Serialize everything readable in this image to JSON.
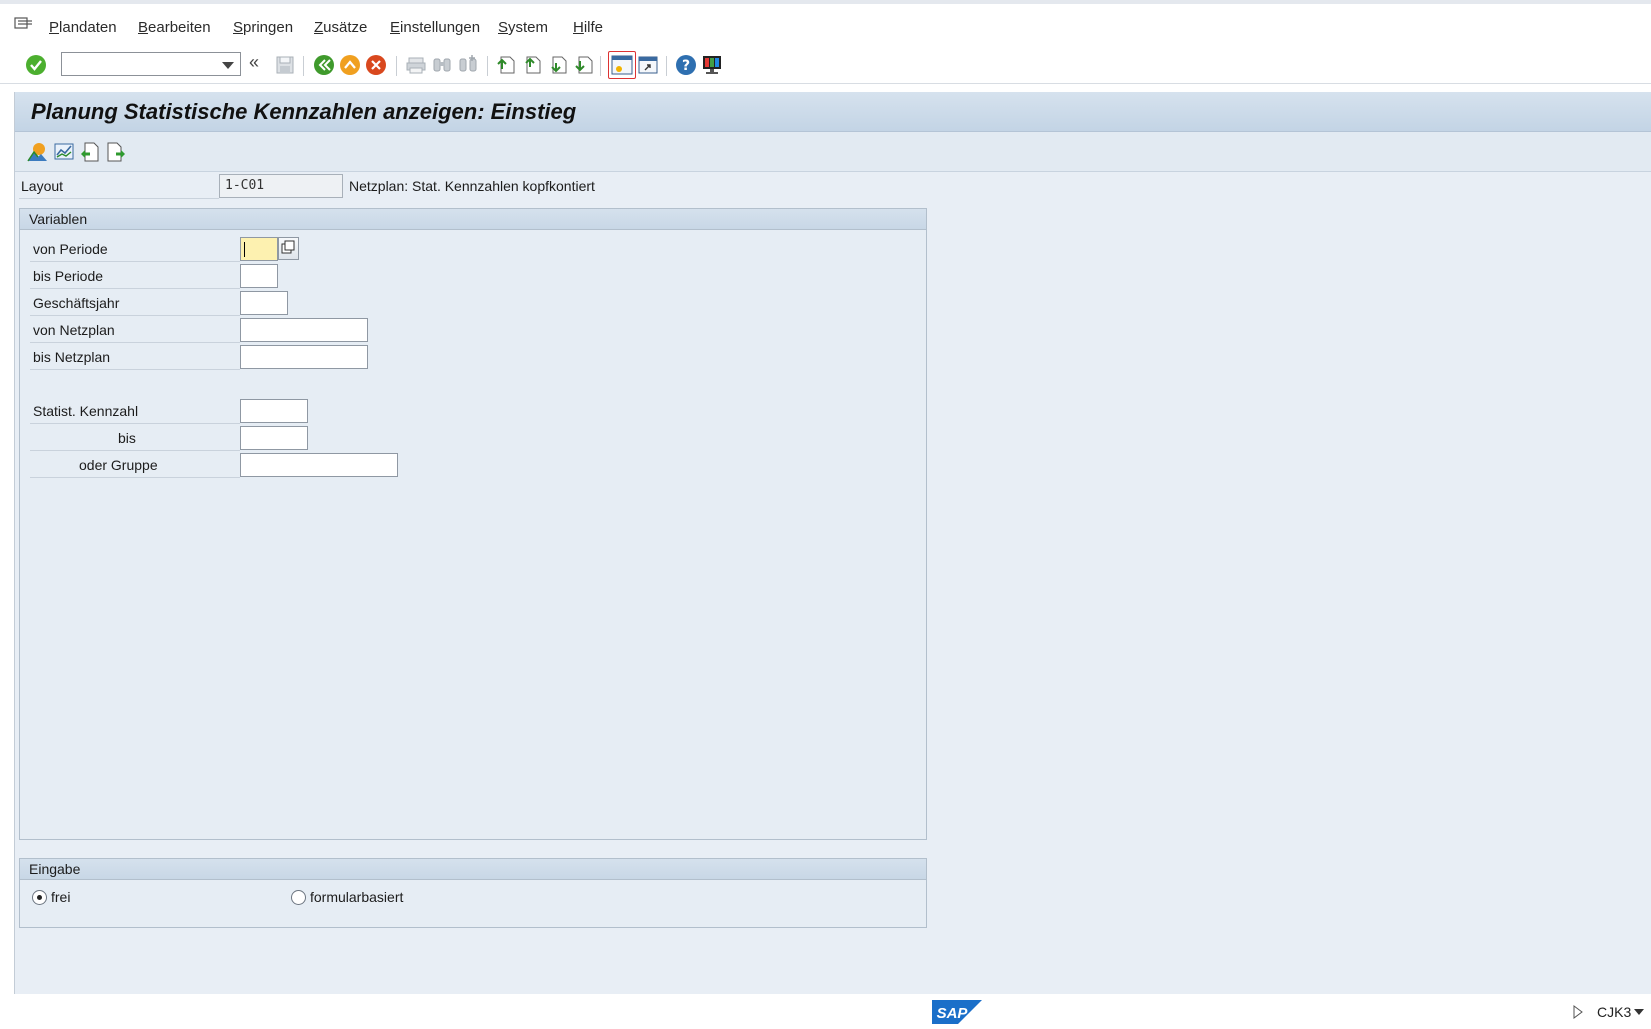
{
  "menubar": {
    "items": [
      {
        "label": "Plandaten",
        "mnemonic": "P",
        "rest": "landaten"
      },
      {
        "label": "Bearbeiten",
        "mnemonic": "B",
        "rest": "earbeiten"
      },
      {
        "label": "Springen",
        "mnemonic": "S",
        "rest": "pringen"
      },
      {
        "label": "Zusätze",
        "mnemonic": "Z",
        "rest": "usätze"
      },
      {
        "label": "Einstellungen",
        "mnemonic": "E",
        "rest": "instellungen"
      },
      {
        "label": "System",
        "mnemonic": "S",
        "rest": "ystem"
      },
      {
        "label": "Hilfe",
        "mnemonic": "H",
        "rest": "ilfe"
      }
    ]
  },
  "toolbar": {
    "command_field_value": "",
    "collapse_glyph": "«"
  },
  "screen": {
    "title": "Planung Statistische Kennzahlen anzeigen: Einstieg"
  },
  "layout": {
    "label": "Layout",
    "value": "1-C01",
    "description": "Netzplan: Stat. Kennzahlen kopfkontiert"
  },
  "variablen": {
    "title": "Variablen",
    "fields": {
      "von_periode": {
        "label": "von Periode",
        "value": ""
      },
      "bis_periode": {
        "label": "bis Periode",
        "value": ""
      },
      "geschaeftsjahr": {
        "label": "Geschäftsjahr",
        "value": ""
      },
      "von_netzplan": {
        "label": "von Netzplan",
        "value": ""
      },
      "bis_netzplan": {
        "label": "bis Netzplan",
        "value": ""
      },
      "statist_kennzahl": {
        "label": "Statist. Kennzahl",
        "value": ""
      },
      "bis": {
        "label": "bis",
        "value": ""
      },
      "oder_gruppe": {
        "label": "oder Gruppe",
        "value": ""
      }
    }
  },
  "eingabe": {
    "title": "Eingabe",
    "options": [
      {
        "label": "frei",
        "selected": true
      },
      {
        "label": "formularbasiert",
        "selected": false
      }
    ]
  },
  "statusbar": {
    "logo_text": "SAP",
    "transaction": "CJK3"
  },
  "colors": {
    "title_bar": "#c3d4e5",
    "screen_background": "#e8eef5",
    "focused_field": "#fdf1b0"
  }
}
